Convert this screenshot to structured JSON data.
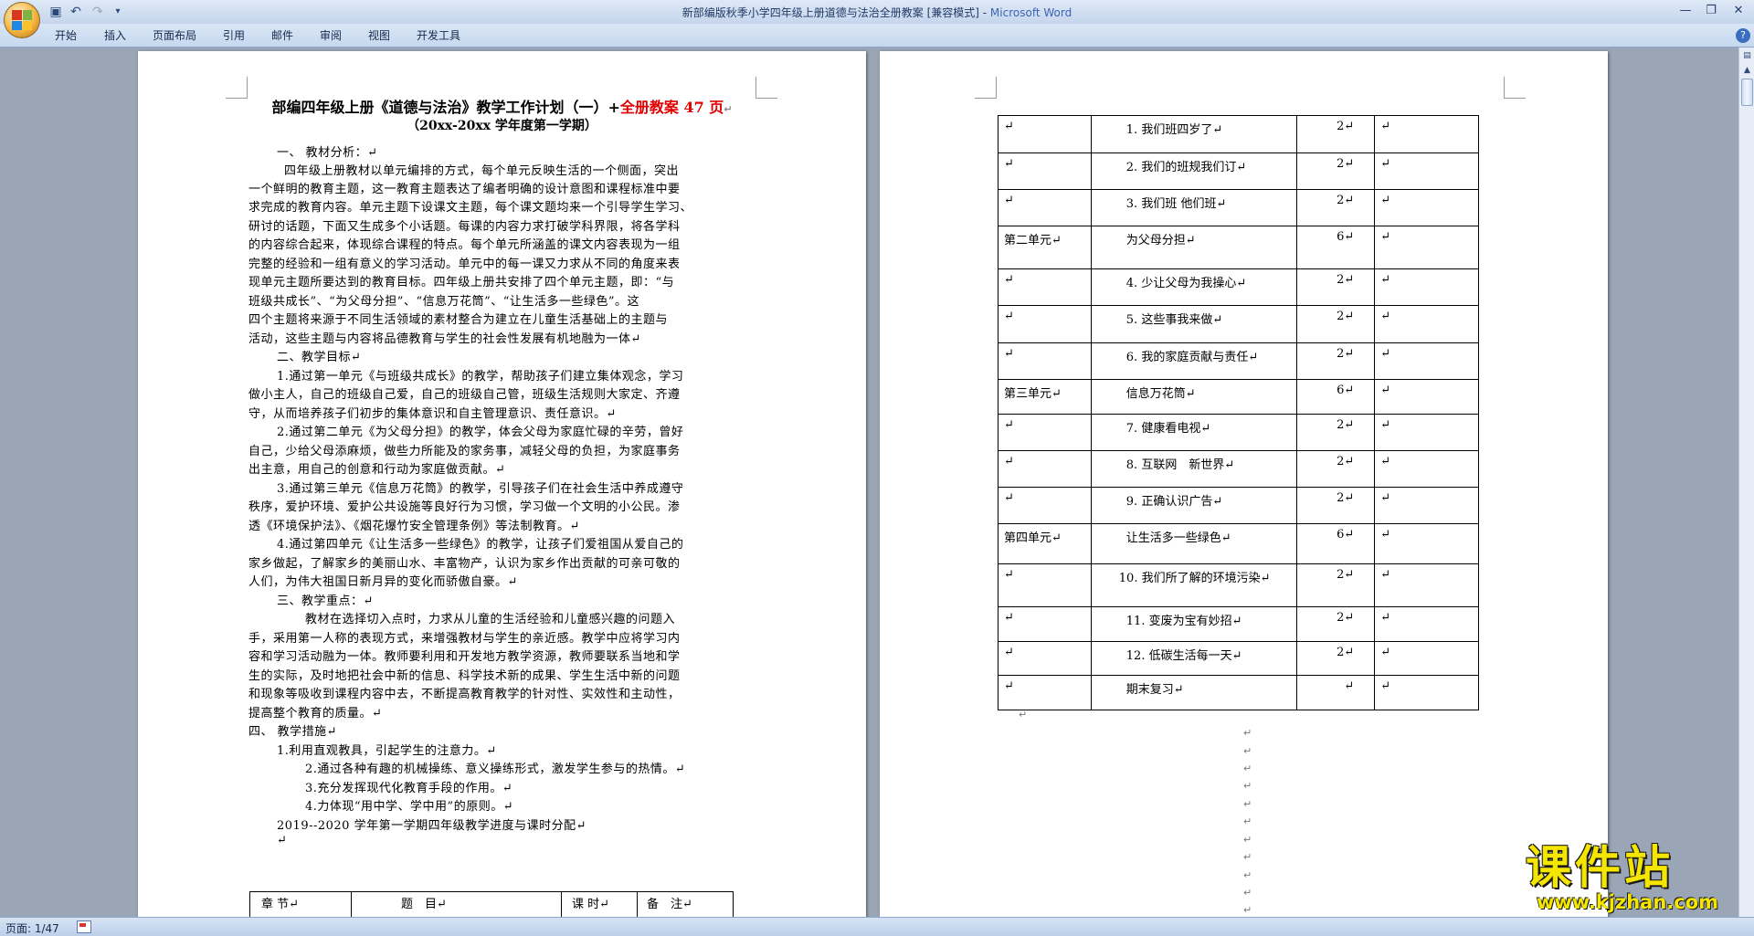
{
  "window": {
    "title_doc": "新部编版秋季小学四年级上册道德与法治全册教案 [兼容模式] - ",
    "title_app": "Microsoft Word"
  },
  "ribbon": {
    "tabs": [
      "开始",
      "插入",
      "页面布局",
      "引用",
      "邮件",
      "审阅",
      "视图",
      "开发工具"
    ]
  },
  "page1": {
    "title_main": "部编四年级上册《道德与法治》教学工作计划（一）+",
    "title_red": "全册教案 47 页",
    "subtitle": "（20xx-20xx 学年度第一学期）",
    "lines": [
      "一、  教材分析：↵",
      "四年级上册教材以单元编排的方式，每个单元反映生活的一个侧面，突出",
      "一个鲜明的教育主题，这一教育主题表达了编者明确的设计意图和课程标准中要",
      "求完成的教育内容。单元主题下设课文主题，每个课文题均来一个引导学生学习、",
      "研讨的话题，下面又生成多个小话题。每课的内容力求打破学科界限，将各学科",
      "的内容综合起来，体现综合课程的特点。每个单元所涵盖的课文内容表现为一组",
      "完整的经验和一组有意义的学习活动。单元中的每一课又力求从不同的角度来表",
      "现单元主题所要达到的教育目标。四年级上册共安排了四个单元主题，即：“与",
      "班级共成长”、“为父母分担”、“信息万花筒”、“让生活多一些绿色”。这",
      "四个主题将来源于不同生活领域的素材整合为建立在儿童生活基础上的主题与",
      "活动，这些主题与内容将品德教育与学生的社会性发展有机地融为一体↵",
      "二、教学目标↵",
      "1.通过第一单元《与班级共成长》的教学，帮助孩子们建立集体观念，学习",
      "做小主人，自己的班级自己爱，自己的班级自己管，班级生活规则大家定、齐遵",
      "守，从而培养孩子们初步的集体意识和自主管理意识、责任意识。↵",
      "2.通过第二单元《为父母分担》的教学，体会父母为家庭忙碌的辛劳，曾好",
      "自己，少给父母添麻烦，做些力所能及的家务事，减轻父母的负担，为家庭事务",
      "出主意，用自己的创意和行动为家庭做贡献。↵",
      "3.通过第三单元《信息万花筒》的教学，引导孩子们在社会生活中养成遵守",
      "秩序，爱护环境、爱护公共设施等良好行为习惯，学习做一个文明的小公民。渗",
      "透《环境保护法》、《烟花爆竹安全管理条例》等法制教育。↵",
      "4.通过第四单元《让生活多一些绿色》的教学，让孩子们爱祖国从爱自己的",
      "家乡做起，了解家乡的美丽山水、丰富物产，认识为家乡作出贡献的可亲可敬的",
      "人们，为伟大祖国日新月异的变化而骄傲自豪。↵",
      "三、教学重点：↵",
      "教材在选择切入点时，力求从儿童的生活经验和儿童感兴趣的问题入",
      "手，采用第一人称的表现方式，来增强教材与学生的亲近感。教学中应将学习内",
      "容和学习活动融为一体。教师要利用和开发地方教学资源，教师要联系当地和学",
      "生的实际，及时地把社会中新的信息、科学技术新的成果、学生生活中新的问题",
      "和现象等吸收到课程内容中去，不断提高教育教学的针对性、实效性和主动性，",
      "提高整个教育的质量。↵",
      "四、  教学措施↵",
      "1.利用直观教具，引起学生的注意力。↵",
      "2.通过各种有趣的机械操练、意义操练形式，激发学生参与的热情。↵",
      "3.充分发挥现代化教育手段的作用。↵",
      "4.力体现“用中学、学中用”的原则。↵",
      "2019--2020 学年第一学期四年级教学进度与课时分配↵",
      "↵"
    ],
    "table_header": [
      "章 节↵",
      "题　目↵",
      "课 时↵",
      "备　注↵"
    ]
  },
  "page2": {
    "rows": [
      {
        "unit": "↵",
        "title": "1. 我们班四岁了↵",
        "hours": "2↵",
        "note": "↵"
      },
      {
        "unit": "↵",
        "title": "2. 我们的班规我们订↵",
        "hours": "2↵",
        "note": "↵"
      },
      {
        "unit": "↵",
        "title": "3. 我们班 他们班↵",
        "hours": "2↵",
        "note": "↵"
      },
      {
        "unit": "第二单元↵",
        "title": "为父母分担↵",
        "hours": "6↵",
        "note": "↵"
      },
      {
        "unit": "↵",
        "title": "4. 少让父母为我操心↵",
        "hours": "2↵",
        "note": "↵"
      },
      {
        "unit": "↵",
        "title": "5. 这些事我来做↵",
        "hours": "2↵",
        "note": "↵"
      },
      {
        "unit": "↵",
        "title": "6. 我的家庭贡献与责任↵",
        "hours": "2↵",
        "note": "↵"
      },
      {
        "unit": "第三单元↵",
        "title": "信息万花筒↵",
        "hours": "6↵",
        "note": "↵"
      },
      {
        "unit": "↵",
        "title": "7. 健康看电视↵",
        "hours": "2↵",
        "note": "↵"
      },
      {
        "unit": "↵",
        "title": "8. 互联网　新世界↵",
        "hours": "2↵",
        "note": "↵"
      },
      {
        "unit": "↵",
        "title": "9. 正确认识广告↵",
        "hours": "2↵",
        "note": "↵"
      },
      {
        "unit": "第四单元↵",
        "title": "让生活多一些绿色↵",
        "hours": "6↵",
        "note": "↵"
      },
      {
        "unit": "↵",
        "title": "10. 我们所了解的环境污染↵",
        "hours": "2↵",
        "note": "↵"
      },
      {
        "unit": "↵",
        "title": "11. 变废为宝有妙招↵",
        "hours": "2↵",
        "note": "↵"
      },
      {
        "unit": "↵",
        "title": "12. 低碳生活每一天↵",
        "hours": "2↵",
        "note": "↵"
      },
      {
        "unit": "↵",
        "title": "期末复习↵",
        "hours": "↵",
        "note": "↵"
      }
    ],
    "after_mark": "↵",
    "para_mark": "↵"
  },
  "statusbar": {
    "page_count": "页面: 1/47"
  },
  "watermark": {
    "name": "课件站",
    "url": "www.kjzhan.com"
  },
  "colors": {
    "accent_red": "#e00000",
    "watermark_yellow": "#f5e600",
    "app_bg": "#9aa6b6"
  }
}
